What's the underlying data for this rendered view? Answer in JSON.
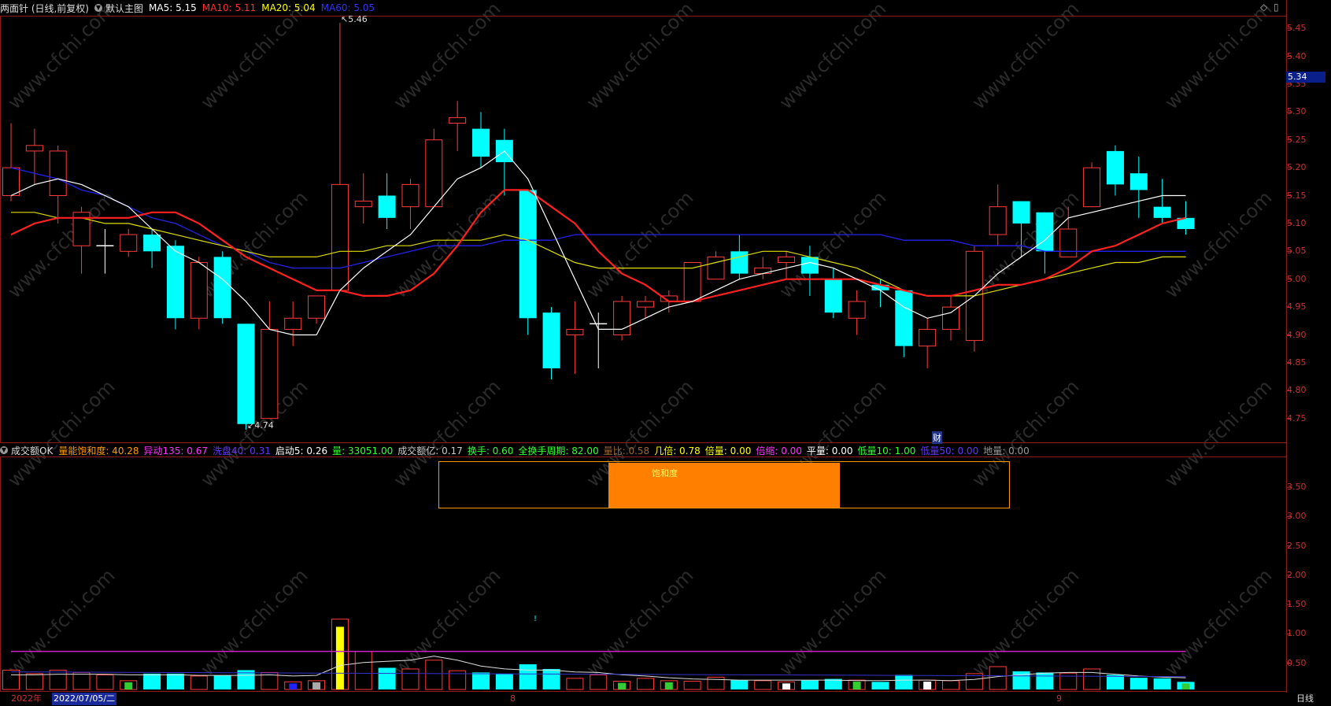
{
  "header": {
    "stock": "两面针 (日线,前复权)",
    "main_chart_label": "默认主图",
    "ma": [
      {
        "text": "MA5: 5.15",
        "color": "#ffffff"
      },
      {
        "text": "MA10: 5.11",
        "color": "#ff3030"
      },
      {
        "text": "MA20: 5.04",
        "color": "#ffff00"
      },
      {
        "text": "MA60: 5.05",
        "color": "#3030ff"
      }
    ]
  },
  "window_controls": {
    "diamond_icon": "◇",
    "restore_icon": "▯"
  },
  "price_axis": {
    "ticks": [
      "5.45",
      "5.40",
      "5.35",
      "5.30",
      "5.25",
      "5.20",
      "5.15",
      "5.10",
      "5.05",
      "5.00",
      "4.95",
      "4.90",
      "4.85",
      "4.80",
      "4.75"
    ],
    "current_price": "5.34",
    "high_label": "5.46",
    "low_label": "4.74",
    "event_label": "财"
  },
  "indicator": {
    "name": "成交额OK",
    "items": [
      {
        "text": "量能饱和度: 40.28",
        "color": "#ff9900"
      },
      {
        "text": "异动135: 0.67",
        "color": "#ff33ff"
      },
      {
        "text": "洗盘40: 0.31",
        "color": "#6633ff"
      },
      {
        "text": "启动5: 0.26",
        "color": "#ffffff"
      },
      {
        "text": "量: 33051.00",
        "color": "#33ff33"
      },
      {
        "text": "成交额亿: 0.17",
        "color": "#cccccc"
      },
      {
        "text": "换手: 0.60",
        "color": "#33ff33"
      },
      {
        "text": "全换手周期: 82.00",
        "color": "#33ff33"
      },
      {
        "text": "量比: 0.58",
        "color": "#996633"
      },
      {
        "text": "几倍: 0.78",
        "color": "#ffff00"
      },
      {
        "text": "倍量: 0.00",
        "color": "#ffff00"
      },
      {
        "text": "倍缩: 0.00",
        "color": "#ff33ff"
      },
      {
        "text": "平量: 0.00",
        "color": "#ffffff"
      },
      {
        "text": "低量10: 1.00",
        "color": "#33ff33"
      },
      {
        "text": "低量50: 0.00",
        "color": "#6633ff"
      },
      {
        "text": "地量: 0.00",
        "color": "#999999"
      }
    ],
    "axis_ticks": [
      "3.50",
      "3.00",
      "2.50",
      "2.00",
      "1.50",
      "1.00",
      "0.50"
    ],
    "saturation_label": "饱和度"
  },
  "date_bar": {
    "year": "2022年",
    "cursor_date": "2022/07/05/二",
    "month8": "8",
    "month9": "9",
    "period": "日线"
  },
  "watermark": "www.cfchi.com",
  "chart_data": {
    "type": "candlestick",
    "price_ylim": [
      4.71,
      5.47
    ],
    "candles": [
      [
        5.15,
        5.2,
        5.28,
        5.14
      ],
      [
        5.23,
        5.24,
        5.27,
        5.17
      ],
      [
        5.15,
        5.23,
        5.24,
        5.1
      ],
      [
        5.06,
        5.12,
        5.13,
        5.01
      ],
      [
        5.06,
        5.06,
        5.09,
        5.01
      ],
      [
        5.05,
        5.08,
        5.09,
        5.04
      ],
      [
        5.08,
        5.05,
        5.09,
        5.02
      ],
      [
        5.06,
        4.93,
        5.07,
        4.91
      ],
      [
        4.93,
        5.03,
        5.04,
        4.91
      ],
      [
        5.04,
        4.93,
        5.05,
        4.92
      ],
      [
        4.92,
        4.74,
        4.92,
        4.73
      ],
      [
        4.75,
        4.91,
        4.96,
        4.75
      ],
      [
        4.91,
        4.93,
        4.96,
        4.88
      ],
      [
        4.93,
        4.97,
        4.97,
        4.92
      ],
      [
        4.98,
        5.17,
        5.46,
        4.98
      ],
      [
        5.13,
        5.14,
        5.19,
        5.1
      ],
      [
        5.15,
        5.11,
        5.19,
        5.09
      ],
      [
        5.13,
        5.17,
        5.18,
        5.09
      ],
      [
        5.13,
        5.25,
        5.27,
        5.13
      ],
      [
        5.28,
        5.29,
        5.32,
        5.23
      ],
      [
        5.27,
        5.22,
        5.3,
        5.2
      ],
      [
        5.25,
        5.21,
        5.27,
        5.15
      ],
      [
        5.16,
        4.93,
        5.16,
        4.9
      ],
      [
        4.94,
        4.84,
        4.95,
        4.82
      ],
      [
        4.9,
        4.91,
        4.96,
        4.83
      ],
      [
        4.92,
        4.92,
        4.94,
        4.84
      ],
      [
        4.9,
        4.96,
        4.97,
        4.89
      ],
      [
        4.95,
        4.96,
        4.97,
        4.93
      ],
      [
        4.96,
        4.97,
        4.98,
        4.94
      ],
      [
        4.96,
        5.03,
        5.03,
        4.96
      ],
      [
        5.0,
        5.04,
        5.05,
        5.0
      ],
      [
        5.05,
        5.01,
        5.08,
        5.0
      ],
      [
        5.01,
        5.02,
        5.04,
        5.0
      ],
      [
        5.03,
        5.04,
        5.05,
        5.0
      ],
      [
        5.04,
        5.01,
        5.06,
        4.97
      ],
      [
        5.0,
        4.94,
        5.02,
        4.93
      ],
      [
        4.93,
        4.96,
        4.98,
        4.9
      ],
      [
        4.99,
        4.98,
        5.0,
        4.95
      ],
      [
        4.98,
        4.88,
        4.98,
        4.86
      ],
      [
        4.88,
        4.91,
        4.93,
        4.84
      ],
      [
        4.91,
        4.95,
        4.97,
        4.89
      ],
      [
        4.89,
        5.05,
        5.06,
        4.87
      ],
      [
        5.08,
        5.13,
        5.17,
        5.06
      ],
      [
        5.14,
        5.1,
        5.14,
        5.04
      ],
      [
        5.12,
        5.05,
        5.12,
        5.01
      ],
      [
        5.04,
        5.09,
        5.13,
        5.04
      ],
      [
        5.13,
        5.2,
        5.21,
        5.13
      ],
      [
        5.23,
        5.17,
        5.24,
        5.15
      ],
      [
        5.19,
        5.16,
        5.22,
        5.11
      ],
      [
        5.13,
        5.11,
        5.18,
        5.1
      ],
      [
        5.11,
        5.09,
        5.14,
        5.08
      ]
    ],
    "ma5": [
      5.15,
      5.17,
      5.18,
      5.17,
      5.15,
      5.13,
      5.09,
      5.05,
      5.03,
      5.0,
      4.96,
      4.91,
      4.9,
      4.9,
      4.98,
      5.02,
      5.05,
      5.08,
      5.13,
      5.18,
      5.2,
      5.23,
      5.18,
      5.09,
      5.0,
      4.91,
      4.91,
      4.93,
      4.95,
      4.96,
      4.98,
      5.0,
      5.01,
      5.02,
      5.03,
      5.02,
      5.0,
      4.98,
      4.95,
      4.93,
      4.94,
      4.97,
      5.01,
      5.04,
      5.07,
      5.11,
      5.12,
      5.13,
      5.14,
      5.15,
      5.15
    ],
    "ma10": [
      5.08,
      5.1,
      5.11,
      5.11,
      5.11,
      5.11,
      5.12,
      5.12,
      5.1,
      5.07,
      5.04,
      5.02,
      5.0,
      4.98,
      4.98,
      4.97,
      4.97,
      4.98,
      5.01,
      5.06,
      5.12,
      5.16,
      5.16,
      5.13,
      5.1,
      5.05,
      5.01,
      4.99,
      4.96,
      4.96,
      4.97,
      4.98,
      4.99,
      5.0,
      5.0,
      5.0,
      5.0,
      4.99,
      4.98,
      4.97,
      4.97,
      4.98,
      4.99,
      4.99,
      5.0,
      5.02,
      5.05,
      5.06,
      5.08,
      5.1,
      5.11
    ],
    "ma20": [
      5.12,
      5.12,
      5.11,
      5.11,
      5.1,
      5.1,
      5.09,
      5.08,
      5.07,
      5.06,
      5.05,
      5.04,
      5.04,
      5.04,
      5.05,
      5.05,
      5.06,
      5.06,
      5.07,
      5.07,
      5.07,
      5.08,
      5.07,
      5.05,
      5.03,
      5.02,
      5.02,
      5.02,
      5.02,
      5.02,
      5.03,
      5.04,
      5.05,
      5.05,
      5.04,
      5.03,
      5.02,
      5.0,
      4.98,
      4.97,
      4.97,
      4.97,
      4.98,
      4.99,
      5.0,
      5.01,
      5.02,
      5.03,
      5.03,
      5.04,
      5.04
    ],
    "ma60": [
      5.2,
      5.19,
      5.18,
      5.16,
      5.15,
      5.13,
      5.11,
      5.1,
      5.08,
      5.06,
      5.05,
      5.03,
      5.02,
      5.02,
      5.02,
      5.03,
      5.04,
      5.05,
      5.06,
      5.06,
      5.06,
      5.07,
      5.07,
      5.07,
      5.08,
      5.08,
      5.08,
      5.08,
      5.08,
      5.08,
      5.08,
      5.08,
      5.08,
      5.08,
      5.08,
      5.08,
      5.08,
      5.08,
      5.07,
      5.07,
      5.07,
      5.06,
      5.06,
      5.06,
      5.05,
      5.05,
      5.05,
      5.05,
      5.05,
      5.05,
      5.05
    ],
    "indicator_ylim": [
      0.05,
      4.0
    ],
    "volume": [
      0.38,
      0.32,
      0.38,
      0.34,
      0.3,
      0.2,
      0.32,
      0.32,
      0.28,
      0.29,
      0.38,
      0.34,
      0.18,
      0.2,
      1.25,
      0.7,
      0.42,
      0.4,
      0.55,
      0.37,
      0.34,
      0.32,
      0.48,
      0.4,
      0.24,
      0.3,
      0.19,
      0.24,
      0.2,
      0.19,
      0.26,
      0.21,
      0.2,
      0.18,
      0.21,
      0.23,
      0.21,
      0.18,
      0.3,
      0.21,
      0.2,
      0.32,
      0.44,
      0.36,
      0.34,
      0.33,
      0.4,
      0.3,
      0.25,
      0.24,
      0.18
    ],
    "volume_special": {
      "14": "#ffff00",
      "12": "#2222ff",
      "13": "#aaaaaa",
      "33": "#ffffff",
      "39": "#ffffff",
      "5": "#33cc33",
      "26": "#33cc33",
      "28": "#33cc33",
      "36": "#33cc33",
      "50": "#33cc33"
    },
    "ref_line_purple": 0.7,
    "ref_line_blue": 0.35,
    "vol_ma": [
      0.3,
      0.3,
      0.31,
      0.31,
      0.31,
      0.3,
      0.3,
      0.3,
      0.29,
      0.29,
      0.29,
      0.3,
      0.28,
      0.29,
      0.46,
      0.51,
      0.53,
      0.55,
      0.62,
      0.55,
      0.45,
      0.4,
      0.38,
      0.38,
      0.35,
      0.34,
      0.3,
      0.28,
      0.25,
      0.23,
      0.22,
      0.21,
      0.21,
      0.21,
      0.21,
      0.21,
      0.2,
      0.2,
      0.21,
      0.21,
      0.2,
      0.22,
      0.27,
      0.3,
      0.33,
      0.34,
      0.34,
      0.31,
      0.28,
      0.26,
      0.25
    ]
  }
}
